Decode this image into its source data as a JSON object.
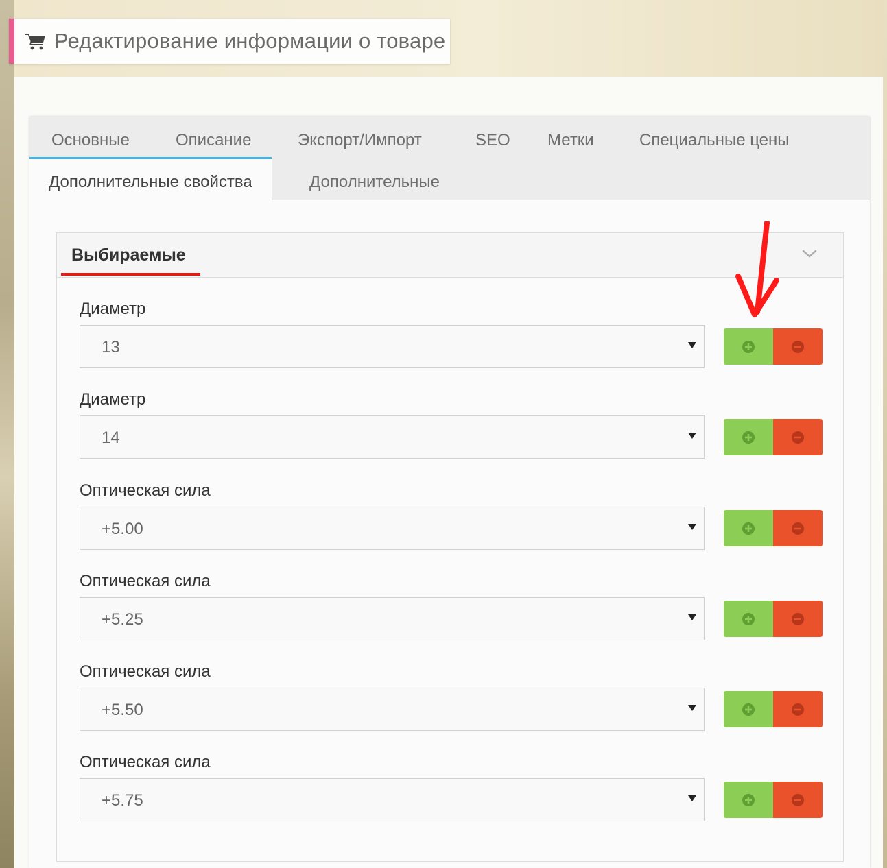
{
  "header": {
    "title": "Редактирование информации о товаре",
    "icon": "shopping-cart-icon"
  },
  "tabs": [
    {
      "label": "Основные",
      "active": false
    },
    {
      "label": "Описание",
      "active": false
    },
    {
      "label": "Экспорт/Импорт",
      "active": false
    },
    {
      "label": "SEO",
      "active": false
    },
    {
      "label": "Метки",
      "active": false
    },
    {
      "label": "Специальные цены",
      "active": false
    },
    {
      "label": "Дополнительные свойства",
      "active": true
    },
    {
      "label": "Дополнительные",
      "active": false
    }
  ],
  "section": {
    "title": "Выбираемые",
    "toggle_icon": "chevron-down-icon"
  },
  "options": [
    {
      "label": "Диаметр",
      "value": "13"
    },
    {
      "label": "Диаметр",
      "value": "14"
    },
    {
      "label": "Оптическая сила",
      "value": "+5.00"
    },
    {
      "label": "Оптическая сила",
      "value": "+5.25"
    },
    {
      "label": "Оптическая сила",
      "value": "+5.50"
    },
    {
      "label": "Оптическая сила",
      "value": "+5.75"
    }
  ],
  "buttons": {
    "add_icon": "plus-circle-icon",
    "remove_icon": "minus-circle-icon"
  },
  "annotation": {
    "icon": "red-arrow-annotation"
  },
  "colors": {
    "tab_active_border": "#3fb4e6",
    "section_underline": "#e21a1a",
    "title_accent": "#e85b8e",
    "add_button": "#8ccd55",
    "remove_button": "#ea522b",
    "annotation_arrow": "#ff1a1a"
  }
}
